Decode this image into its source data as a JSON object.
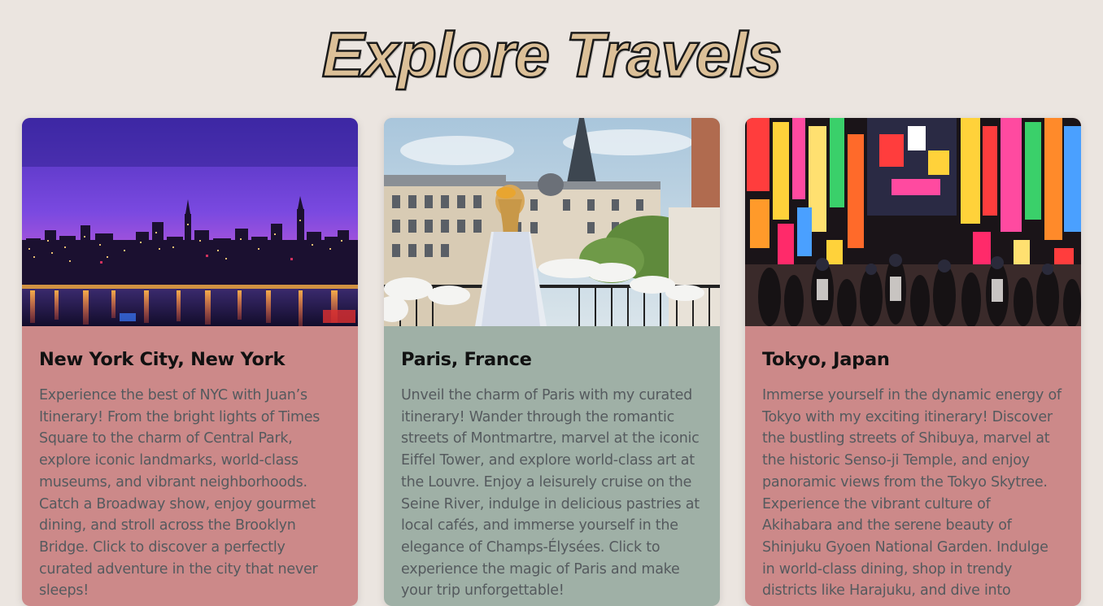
{
  "page": {
    "title": "Explore Travels"
  },
  "colors": {
    "background": "#ebe5e0",
    "title_fill": "#dcc098",
    "card_rose": "#cc8989",
    "card_sage": "#9fb0a6",
    "description_text": "#555a5e"
  },
  "cards": [
    {
      "title": "New York City, New York",
      "description": "Experience the best of NYC with Juan’s Itinerary! From the bright lights of Times Square to the charm of Central Park, explore iconic landmarks, world-class museums, and vibrant neighborhoods. Catch a Broadway show, enjoy gourmet dining, and stroll across the Brooklyn Bridge. Click to discover a perfectly curated adventure in the city that never sleeps!",
      "image": "nyc-skyline-night-photo",
      "color": "#cc8989"
    },
    {
      "title": "Paris, France",
      "description": "Unveil the charm of Paris with my curated itinerary! Wander through the romantic streets of Montmartre, marvel at the iconic Eiffel Tower, and explore world-class art at the Louvre. Enjoy a leisurely cruise on the Seine River, indulge in delicious pastries at local cafés, and immerse yourself in the elegance of Champs-Élysées. Click to experience the magic of Paris and make your trip unforgettable!",
      "image": "paris-eiffel-balcony-photo",
      "color": "#9fb0a6"
    },
    {
      "title": "Tokyo, Japan",
      "description": "Immerse yourself in the dynamic energy of Tokyo with my exciting itinerary! Discover the bustling streets of Shibuya, marvel at the historic Senso-ji Temple, and enjoy panoramic views from the Tokyo Skytree. Experience the vibrant culture of Akihabara and the serene beauty of Shinjuku Gyoen National Garden. Indulge in world-class dining, shop in trendy districts like Harajuku, and dive into",
      "image": "tokyo-neon-street-photo",
      "color": "#cc8989"
    }
  ]
}
